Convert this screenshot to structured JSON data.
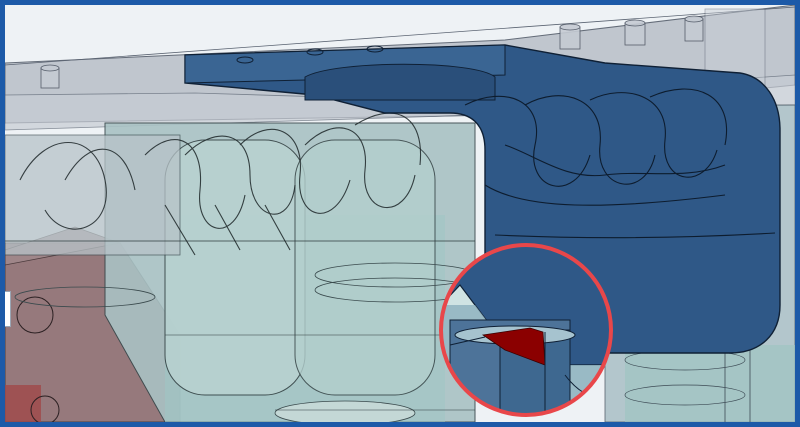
{
  "viewer": {
    "view_type": "3d-cad-viewport",
    "frame_color": "#1d5aa8",
    "colors": {
      "bracket": "#2f5887",
      "bracket_edge": "#0f2035",
      "glass": "#9cc7c3",
      "glass_body": "#a9c2c4",
      "highlight_fill": "#8b0000",
      "highlight_ring": "#e8474a",
      "left_block": "#8d6c6f"
    },
    "highlight": {
      "shape": "circle",
      "label": ""
    }
  }
}
